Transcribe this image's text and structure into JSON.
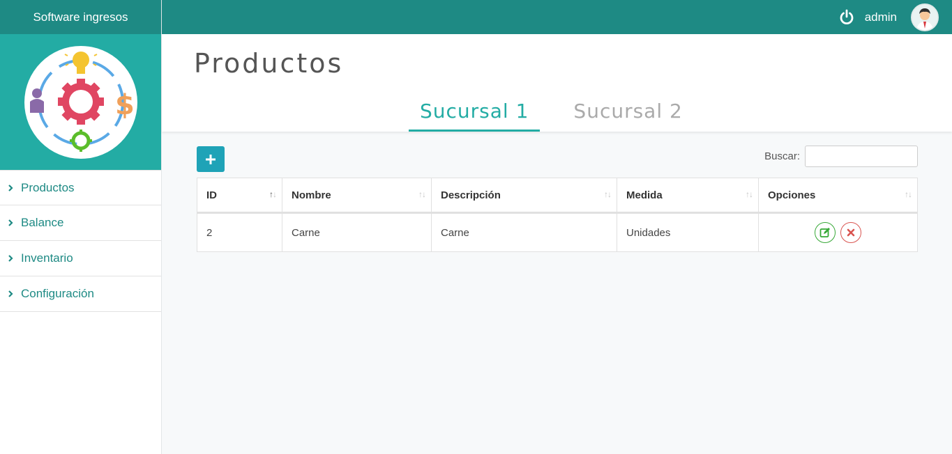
{
  "app": {
    "title": "Software ingresos"
  },
  "sidebar": {
    "items": [
      {
        "label": "Productos"
      },
      {
        "label": "Balance"
      },
      {
        "label": "Inventario"
      },
      {
        "label": "Configuración"
      }
    ]
  },
  "topbar": {
    "username": "admin",
    "power_icon": "power-icon",
    "avatar_icon": "user-avatar"
  },
  "page": {
    "title": "Productos"
  },
  "tabs": [
    {
      "label": "Sucursal 1",
      "active": true
    },
    {
      "label": "Sucursal 2",
      "active": false
    }
  ],
  "toolbar": {
    "add_label": "+",
    "search_label": "Buscar:",
    "search_value": ""
  },
  "table": {
    "columns": [
      "ID",
      "Nombre",
      "Descripción",
      "Medida",
      "Opciones"
    ],
    "rows": [
      {
        "id": "2",
        "nombre": "Carne",
        "descripcion": "Carne",
        "medida": "Unidades"
      }
    ]
  },
  "colors": {
    "primary_dark": "#1e8a84",
    "primary": "#23aca4",
    "add_button": "#1fa3b7",
    "edit": "#36a836",
    "delete": "#d9534f"
  }
}
